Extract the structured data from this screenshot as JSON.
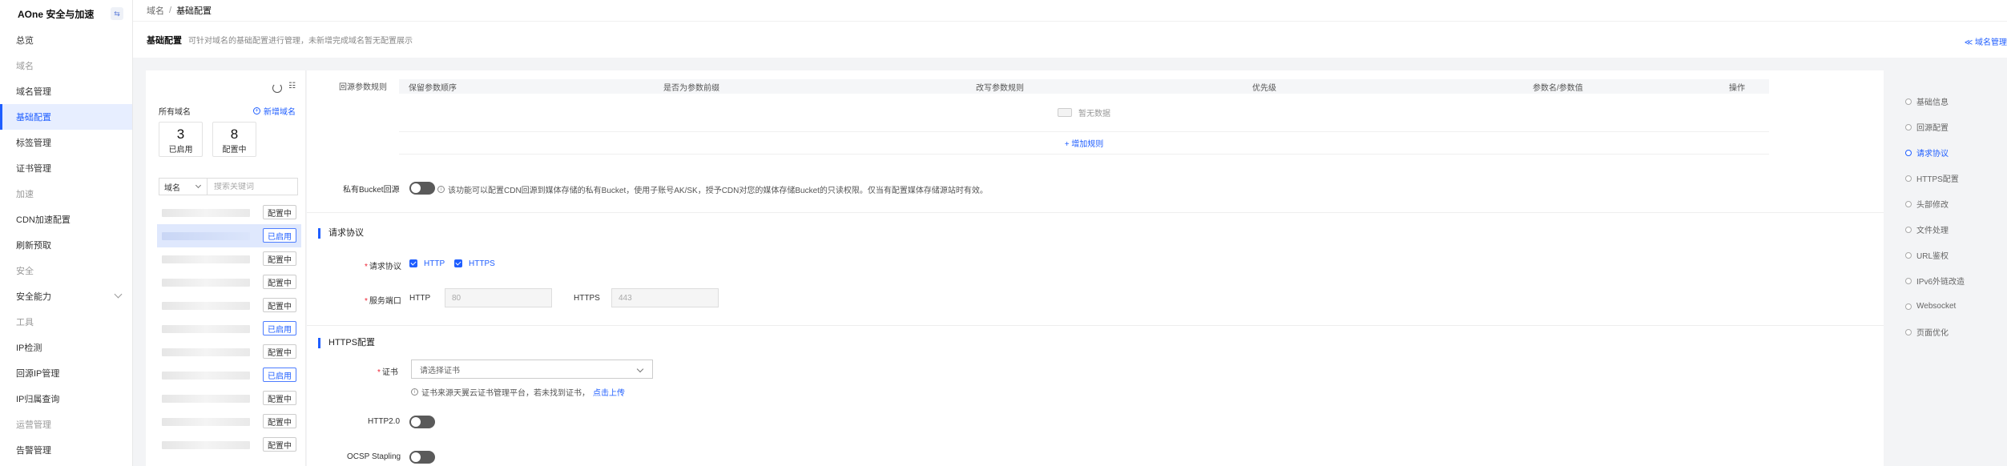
{
  "sidebar": {
    "brand": "AOne 安全与加速",
    "brand_toggle": "⇆",
    "items": [
      {
        "label": "总览",
        "type": "item"
      },
      {
        "label": "域名",
        "type": "group"
      },
      {
        "label": "域名管理",
        "type": "item"
      },
      {
        "label": "基础配置",
        "type": "active"
      },
      {
        "label": "标签管理",
        "type": "item"
      },
      {
        "label": "证书管理",
        "type": "item"
      },
      {
        "label": "加速",
        "type": "group"
      },
      {
        "label": "CDN加速配置",
        "type": "item"
      },
      {
        "label": "刷新预取",
        "type": "item"
      },
      {
        "label": "安全",
        "type": "group"
      },
      {
        "label": "安全能力",
        "type": "expand"
      },
      {
        "label": "工具",
        "type": "group"
      },
      {
        "label": "IP检测",
        "type": "item"
      },
      {
        "label": "回源IP管理",
        "type": "item"
      },
      {
        "label": "IP归属查询",
        "type": "item"
      },
      {
        "label": "运营管理",
        "type": "group"
      },
      {
        "label": "告警管理",
        "type": "item"
      }
    ]
  },
  "breadcrumb": {
    "root": "域名",
    "separator": "/",
    "current": "基础配置"
  },
  "header": {
    "title": "基础配置",
    "description": "可针对域名的基础配置进行管理，未新增完成域名暂无配置展示",
    "link": "≪ 域名管理"
  },
  "domain_panel": {
    "tool_label": "☷",
    "all_domains_label": "所有域名",
    "add_domain_label": "新增域名",
    "stats": [
      {
        "num": "3",
        "label": "已启用"
      },
      {
        "num": "8",
        "label": "配置中"
      }
    ],
    "search_select": "域名",
    "search_placeholder": "搜索关键词",
    "domains": [
      {
        "tag": "配置中",
        "status": "cfg",
        "selected": false
      },
      {
        "tag": "已启用",
        "status": "on",
        "selected": true
      },
      {
        "tag": "配置中",
        "status": "cfg",
        "selected": false
      },
      {
        "tag": "配置中",
        "status": "cfg",
        "selected": false
      },
      {
        "tag": "配置中",
        "status": "cfg",
        "selected": false
      },
      {
        "tag": "已启用",
        "status": "on",
        "selected": false
      },
      {
        "tag": "配置中",
        "status": "cfg",
        "selected": false
      },
      {
        "tag": "已启用",
        "status": "on",
        "selected": false
      },
      {
        "tag": "配置中",
        "status": "cfg",
        "selected": false
      },
      {
        "tag": "配置中",
        "status": "cfg",
        "selected": false
      },
      {
        "tag": "配置中",
        "status": "cfg",
        "selected": false
      }
    ]
  },
  "origin_params": {
    "label": "回源参数规则",
    "columns": [
      "保留参数顺序",
      "是否为参数前缀",
      "改写参数规则",
      "优先级",
      "参数名/参数值",
      "操作"
    ],
    "empty_text": "暂无数据",
    "add_rule": "+ 增加规则"
  },
  "private_bucket": {
    "label": "私有Bucket回源",
    "description": "该功能可以配置CDN回源到媒体存储的私有Bucket，使用子账号AK/SK，授予CDN对您的媒体存储Bucket的只读权限。仅当有配置媒体存储源站时有效。"
  },
  "request_protocol": {
    "title": "请求协议",
    "protocol_label": "请求协议",
    "options": [
      "HTTP",
      "HTTPS"
    ],
    "port_label": "服务端口",
    "http_label": "HTTP",
    "http_port": "80",
    "https_label": "HTTPS",
    "https_port": "443"
  },
  "https_config": {
    "title": "HTTPS配置",
    "cert_label": "证书",
    "cert_placeholder": "请选择证书",
    "cert_desc": "证书来源天翼云证书管理平台，若未找到证书，",
    "cert_link": "点击上传",
    "http2_label": "HTTP2.0",
    "ocsp_label": "OCSP Stapling"
  },
  "anchors": [
    {
      "label": "基础信息",
      "active": false
    },
    {
      "label": "回源配置",
      "active": false
    },
    {
      "label": "请求协议",
      "active": true
    },
    {
      "label": "HTTPS配置",
      "active": false
    },
    {
      "label": "头部修改",
      "active": false
    },
    {
      "label": "文件处理",
      "active": false
    },
    {
      "label": "URL鉴权",
      "active": false
    },
    {
      "label": "IPv6外链改造",
      "active": false
    },
    {
      "label": "Websocket",
      "active": false
    },
    {
      "label": "页面优化",
      "active": false
    }
  ],
  "colors": {
    "accent": "#1f5eff",
    "toggle_off": "#5a5a5a"
  }
}
